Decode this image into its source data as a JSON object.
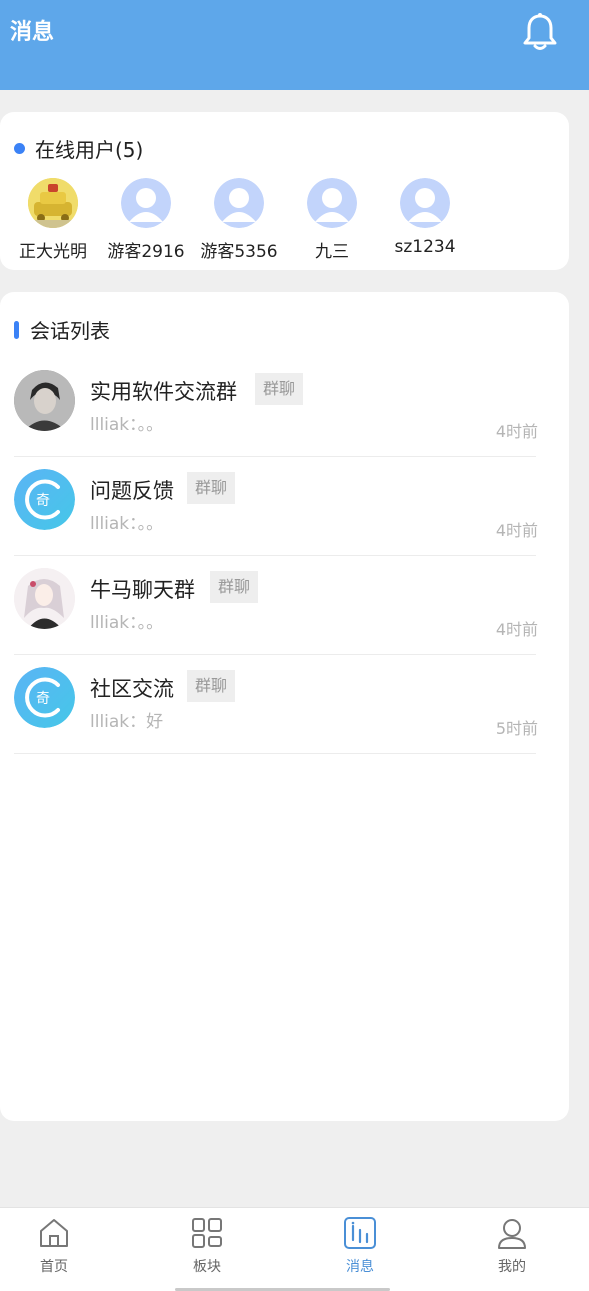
{
  "header": {
    "title": "消息",
    "icon": "bell-icon",
    "bg_color": "#5ea7ea"
  },
  "online": {
    "title": "在线用户(5)",
    "users": [
      {
        "name": "正大光明",
        "avatar": "custom-avatar"
      },
      {
        "name": "游客2916",
        "avatar": "default-avatar"
      },
      {
        "name": "游客5356",
        "avatar": "default-avatar"
      },
      {
        "name": "九三",
        "avatar": "default-avatar"
      },
      {
        "name": "sz1234",
        "avatar": "default-avatar"
      }
    ]
  },
  "conversations": {
    "title": "会话列表",
    "items": [
      {
        "name": "实用软件交流群",
        "tag": "群聊",
        "message": "llliak：。。",
        "time": "4时前"
      },
      {
        "name": "问题反馈",
        "tag": "群聊",
        "message": "llliak：。。",
        "time": "4时前"
      },
      {
        "name": "牛马聊天群",
        "tag": "群聊",
        "message": "llliak：。。",
        "time": "4时前"
      },
      {
        "name": "社区交流",
        "tag": "群聊",
        "message": "llliak：好",
        "time": "5时前"
      }
    ],
    "app_logo_char": "奇"
  },
  "tabbar": {
    "tabs": [
      {
        "label": "首页",
        "icon": "home-icon"
      },
      {
        "label": "板块",
        "icon": "grid-icon"
      },
      {
        "label": "消息",
        "icon": "message-icon",
        "active": true
      },
      {
        "label": "我的",
        "icon": "user-icon"
      }
    ],
    "active_color": "#4a8fd6"
  }
}
